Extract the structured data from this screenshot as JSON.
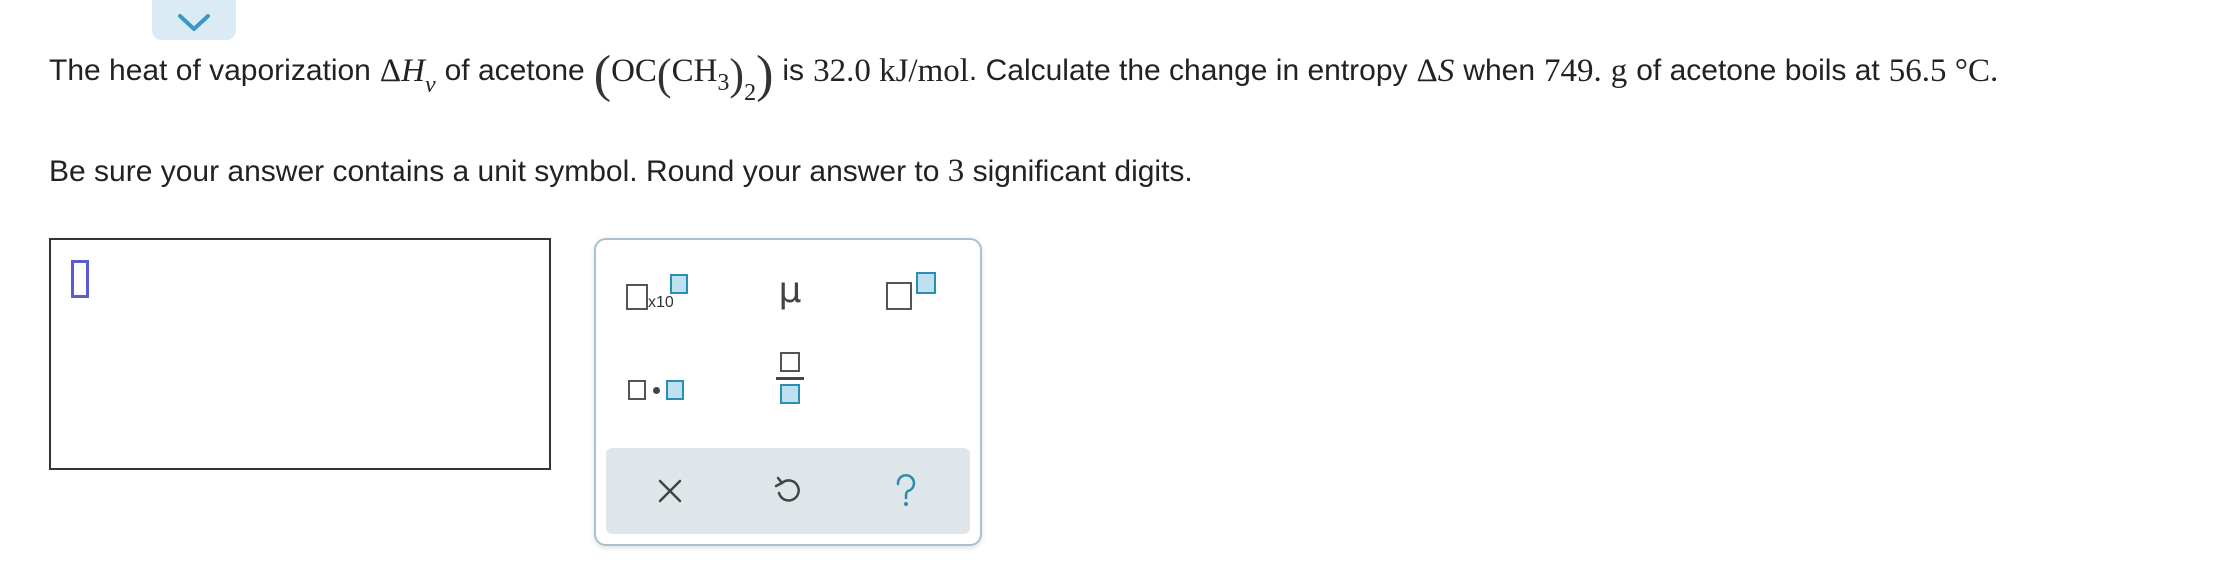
{
  "question": {
    "p1": "The heat of vaporization",
    "delta": "Δ",
    "H": "H",
    "v": "v",
    "p2": "of acetone",
    "OC": "OC",
    "CH": "CH",
    "three": "3",
    "two": "2",
    "p3": "is",
    "value": "32.0 kJ/mol",
    "p4": ". Calculate the change in entropy",
    "S": "S",
    "p5": "when",
    "mass": "749.",
    "g": "g",
    "p6": "of acetone boils at",
    "temp": "56.5 °C",
    "end": "."
  },
  "instruction": {
    "p1": "Be sure your answer contains a unit symbol. Round your answer to",
    "num": "3",
    "p2": "significant digits."
  },
  "palette": {
    "x10_label": "x10",
    "mu": "μ"
  },
  "colors": {
    "accent_blue": "#2a8db3",
    "tab_bg": "#daebf3",
    "cursor": "#5a5ad6"
  }
}
